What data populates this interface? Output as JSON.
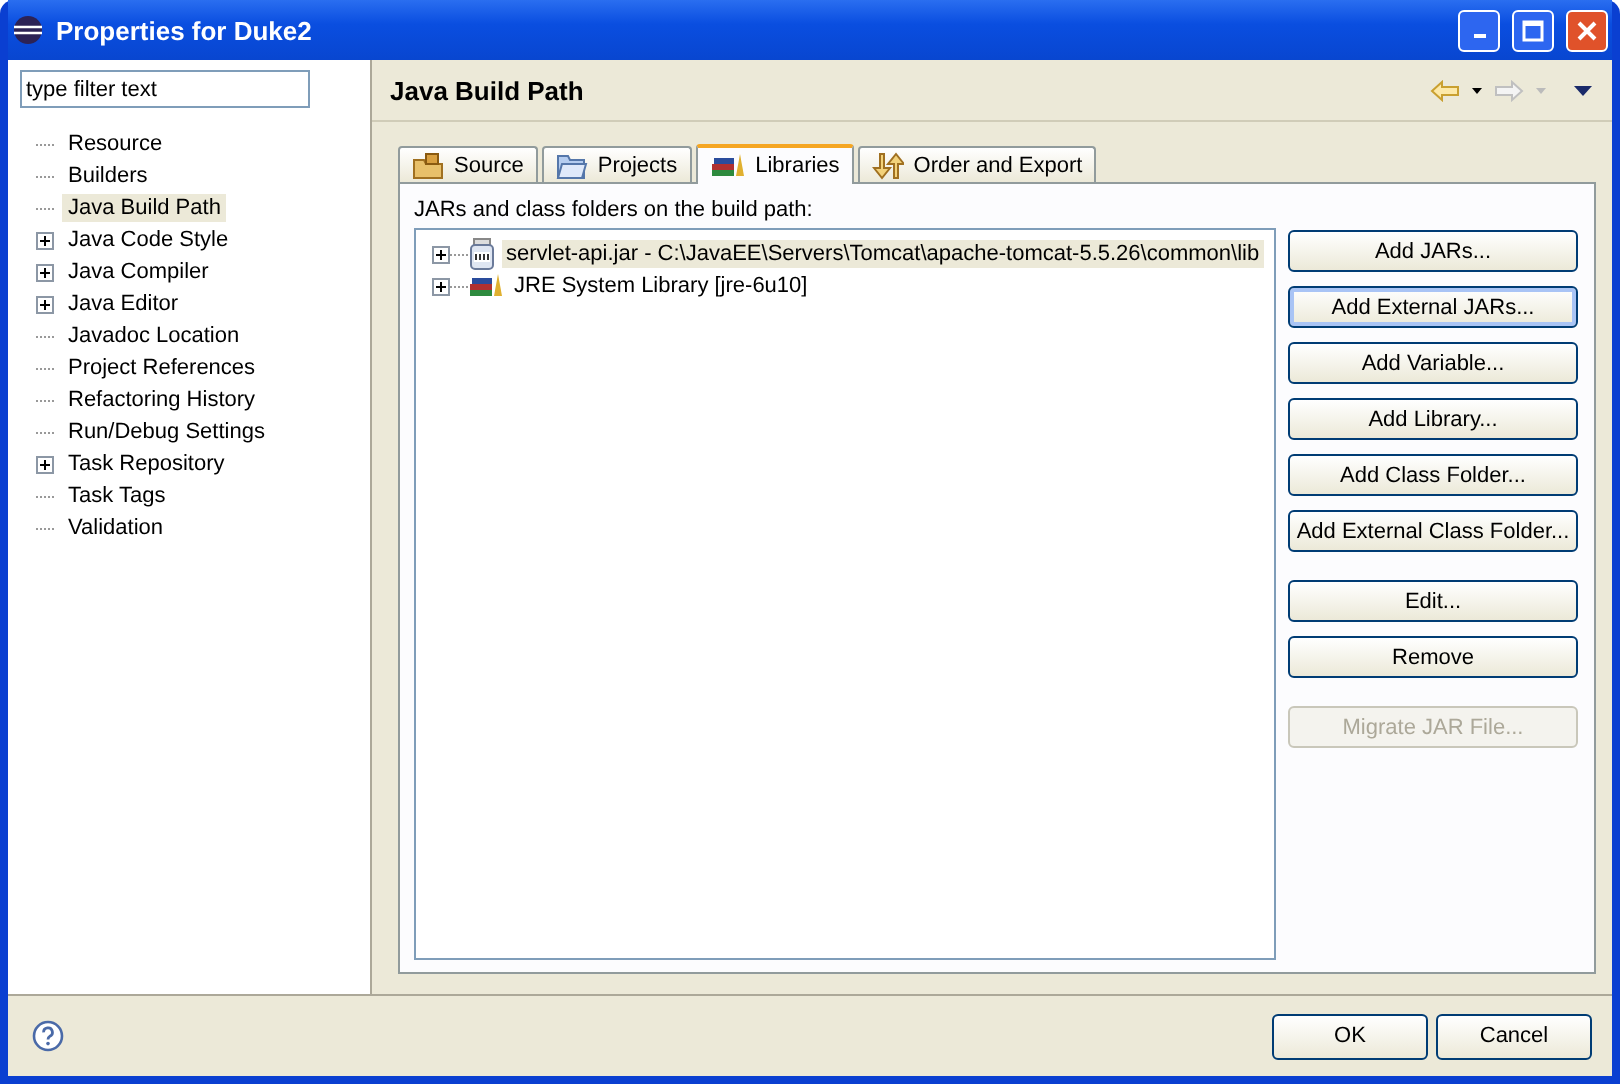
{
  "window": {
    "title": "Properties for Duke2"
  },
  "filter": {
    "placeholder": "type filter text"
  },
  "sidebar": {
    "items": [
      {
        "label": "Resource",
        "selected": false
      },
      {
        "label": "Builders",
        "selected": false
      },
      {
        "label": "Java Build Path",
        "selected": true
      },
      {
        "label": "Java Code Style",
        "selected": false,
        "expanded": false
      },
      {
        "label": "Java Compiler",
        "selected": false,
        "expanded": false
      },
      {
        "label": "Java Editor",
        "selected": false,
        "expanded": false
      },
      {
        "label": "Javadoc Location",
        "selected": false
      },
      {
        "label": "Project References",
        "selected": false
      },
      {
        "label": "Refactoring History",
        "selected": false
      },
      {
        "label": "Run/Debug Settings",
        "selected": false
      },
      {
        "label": "Task Repository",
        "selected": false,
        "expanded": false
      },
      {
        "label": "Task Tags",
        "selected": false
      },
      {
        "label": "Validation",
        "selected": false
      }
    ]
  },
  "page": {
    "title": "Java Build Path",
    "tabs": [
      {
        "label": "Source",
        "kind": "source",
        "selected": false
      },
      {
        "label": "Projects",
        "kind": "projects",
        "selected": false
      },
      {
        "label": "Libraries",
        "kind": "libraries",
        "selected": true
      },
      {
        "label": "Order and Export",
        "kind": "order",
        "selected": false
      }
    ],
    "list_label": "JARs and class folders on the build path:",
    "entries": [
      {
        "label": "servlet-api.jar - C:\\JavaEE\\Servers\\Tomcat\\apache-tomcat-5.5.26\\common\\lib",
        "kind": "jar",
        "selected": true,
        "expanded": false
      },
      {
        "label": "JRE System Library [jre-6u10]",
        "kind": "library",
        "selected": false,
        "expanded": false
      }
    ],
    "button_groups": [
      [
        {
          "label": "Add JARs...",
          "focused": false,
          "disabled": false
        },
        {
          "label": "Add External JARs...",
          "focused": true,
          "disabled": false
        },
        {
          "label": "Add Variable...",
          "focused": false,
          "disabled": false
        },
        {
          "label": "Add Library...",
          "focused": false,
          "disabled": false
        },
        {
          "label": "Add Class Folder...",
          "focused": false,
          "disabled": false
        },
        {
          "label": "Add External Class Folder...",
          "focused": false,
          "disabled": false
        }
      ],
      [
        {
          "label": "Edit...",
          "focused": false,
          "disabled": false
        },
        {
          "label": "Remove",
          "focused": false,
          "disabled": false
        }
      ],
      [
        {
          "label": "Migrate JAR File...",
          "focused": false,
          "disabled": true
        }
      ]
    ]
  },
  "footer": {
    "buttons": [
      "OK",
      "Cancel"
    ]
  }
}
